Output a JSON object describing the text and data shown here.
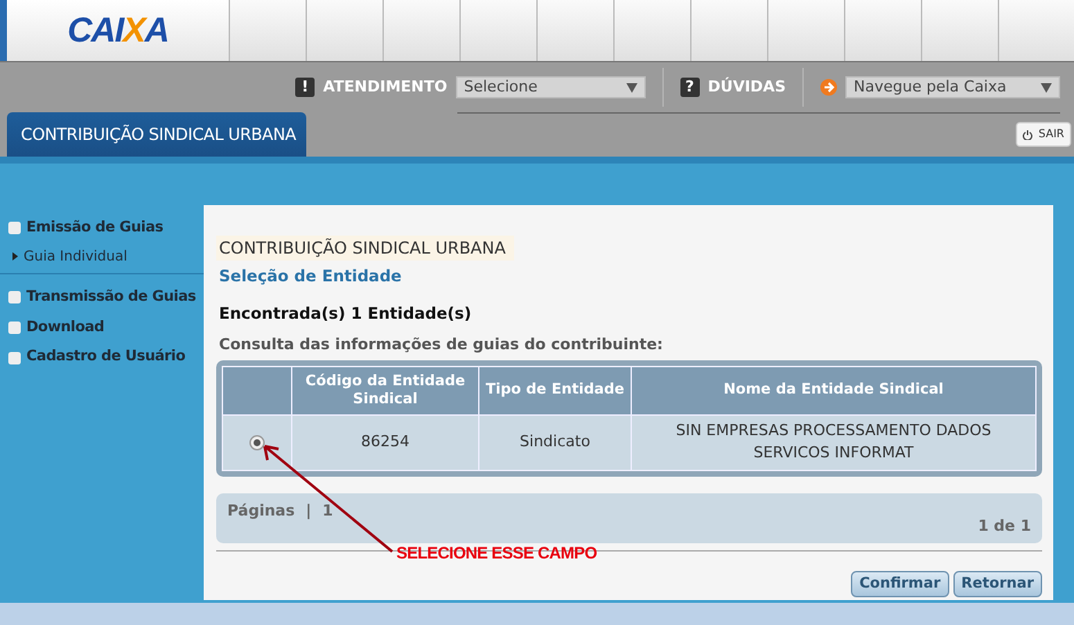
{
  "header": {
    "logo": "CAIXA"
  },
  "toolbar": {
    "atendimento": {
      "icon": "!",
      "label": "ATENDIMENTO",
      "value": "Selecione"
    },
    "duvidas": {
      "icon": "?",
      "label": "DÚVIDAS"
    },
    "navegue": {
      "value": "Navegue pela Caixa"
    }
  },
  "tab": {
    "label": "CONTRIBUIÇÃO SINDICAL URBANA",
    "selected": true
  },
  "logout": {
    "label": "SAIR"
  },
  "sidebar": {
    "items": [
      {
        "label": "Emissão de Guias",
        "children": [
          {
            "label": "Guia Individual"
          }
        ]
      },
      {
        "label": "Transmissão de Guias"
      },
      {
        "label": "Download"
      },
      {
        "label": "Cadastro de Usuário"
      }
    ]
  },
  "main": {
    "title": "CONTRIBUIÇÃO SINDICAL URBANA",
    "subtitle": "Seleção de Entidade",
    "found": "Encontrada(s) 1 Entidade(s)",
    "caption": "Consulta das informações de guias do contribuinte:",
    "table": {
      "columns": [
        "Código da Entidade Sindical",
        "Tipo de Entidade",
        "Nome da Entidade Sindical"
      ],
      "rows": [
        {
          "selected": true,
          "cells": [
            "86254",
            "Sindicato",
            "SIN EMPRESAS PROCESSAMENTO DADOS SERVICOS INFORMAT"
          ]
        }
      ]
    },
    "pagination": {
      "label": "Páginas",
      "separator": "|",
      "pages": [
        "1"
      ],
      "summary": "1 de 1"
    },
    "buttons": [
      "Confirmar",
      "Retornar"
    ]
  },
  "annotation": {
    "text": "SELECIONE ESSE CAMPO"
  }
}
